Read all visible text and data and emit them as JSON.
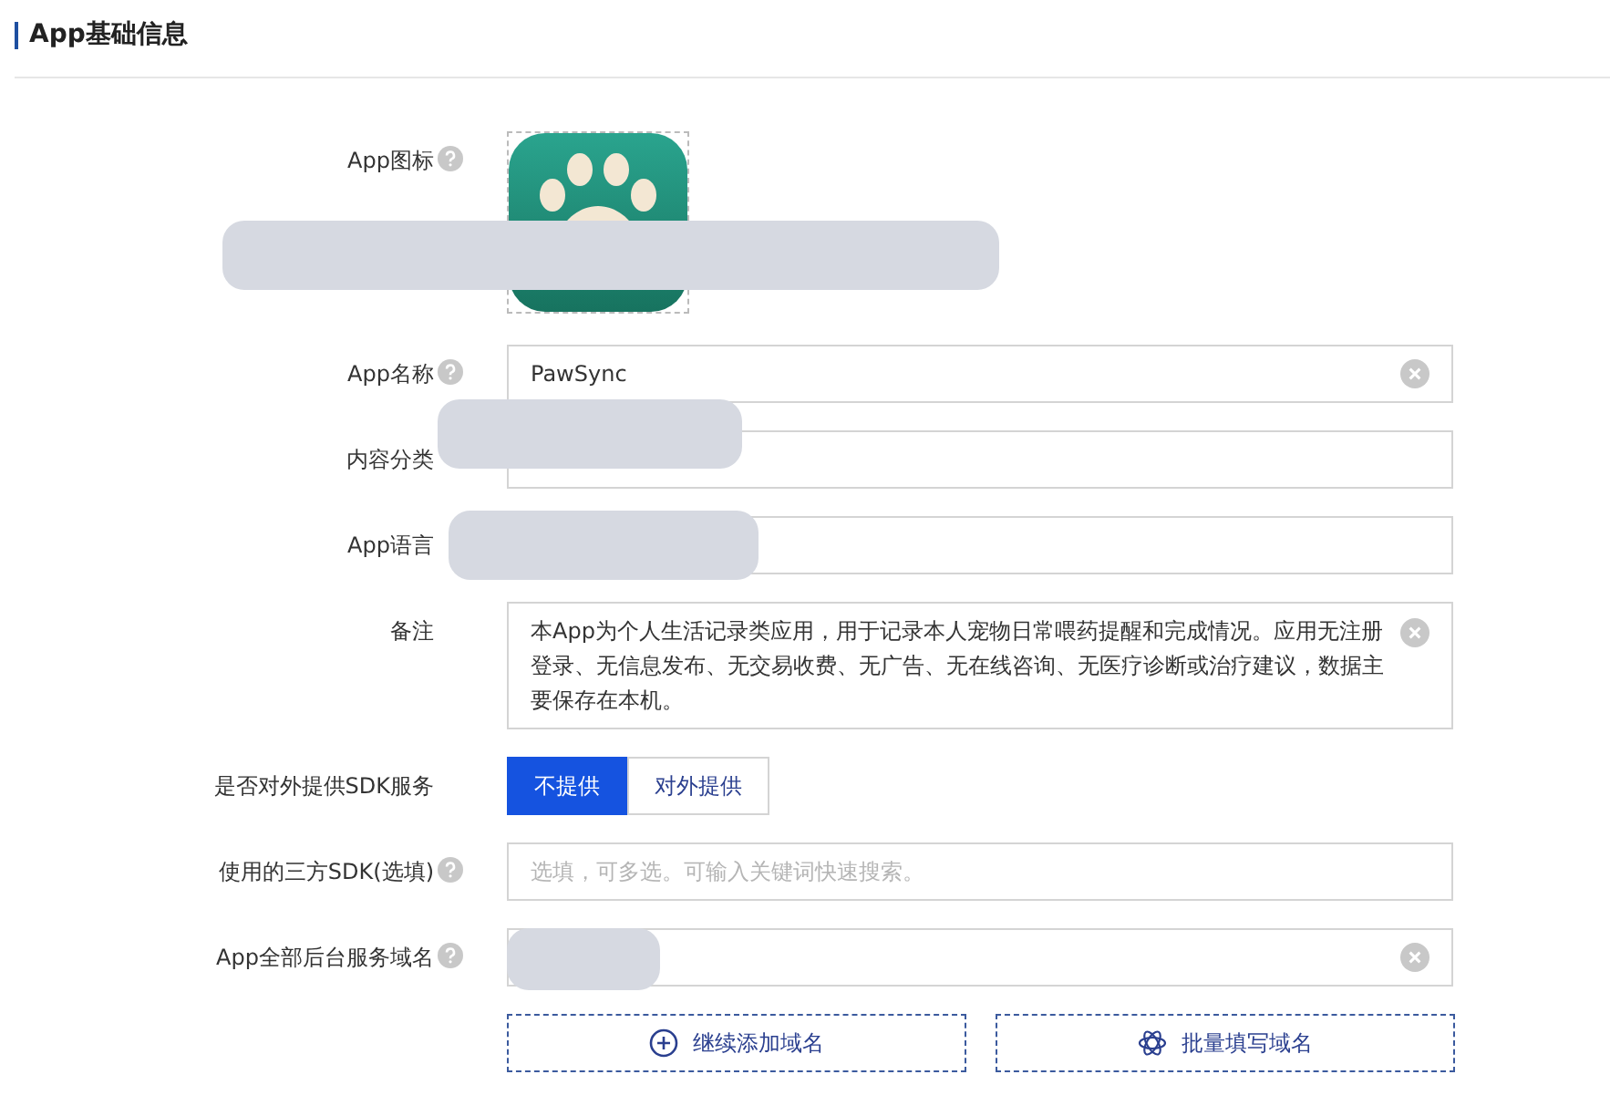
{
  "section": {
    "title": "App基础信息"
  },
  "fields": [
    {
      "kind": "icon",
      "label": "App图标",
      "help": true,
      "redacted": true
    },
    {
      "kind": "text",
      "label": "App名称",
      "help": true,
      "value": "PawSync",
      "clearable": true,
      "redacted": false
    },
    {
      "kind": "text",
      "label": "内容分类",
      "help": false,
      "redacted": true
    },
    {
      "kind": "text",
      "label": "App语言",
      "help": false,
      "redacted": true
    },
    {
      "kind": "textarea",
      "label": "备注",
      "help": false,
      "value": "本App为个人生活记录类应用，用于记录本人宠物日常喂药提醒和完成情况。应用无注册登录、无信息发布、无交易收费、无广告、无在线咨询、无医疗诊断或治疗建议，数据主要保存在本机。",
      "clearable": true,
      "redacted": false
    },
    {
      "kind": "toggle",
      "label": "是否对外提供SDK服务",
      "help": false,
      "options": [
        {
          "label": "不提供",
          "selected": true
        },
        {
          "label": "对外提供",
          "selected": false
        }
      ],
      "redacted": false
    },
    {
      "kind": "text",
      "label": "使用的三方SDK(选填)",
      "help": true,
      "placeholder": "选填，可多选。可输入关键词快速搜索。",
      "clearable": false,
      "redacted": false
    },
    {
      "kind": "text",
      "label": "App全部后台服务域名",
      "help": true,
      "clearable": true,
      "redacted": true
    }
  ],
  "actions": [
    {
      "kind": "add",
      "label": "继续添加域名"
    },
    {
      "kind": "batch",
      "label": "批量填写域名"
    }
  ]
}
